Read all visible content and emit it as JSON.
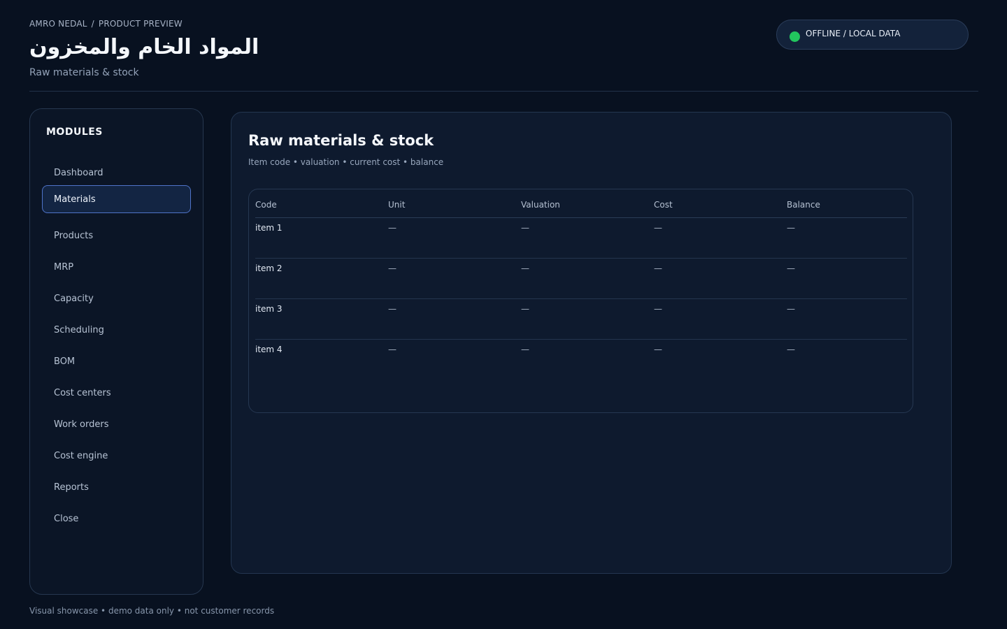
{
  "breadcrumb": {
    "owner": "AMRO NEDAL",
    "separator": "/",
    "section": "PRODUCT PREVIEW"
  },
  "header": {
    "title": "المواد الخام والمخزون",
    "subtitle": "Raw materials & stock"
  },
  "status": {
    "label": "OFFLINE / LOCAL DATA",
    "color": "#22c55e"
  },
  "sidebar": {
    "heading": "MODULES",
    "active": "Materials",
    "items": [
      {
        "label": "Dashboard"
      },
      {
        "label": "Materials"
      },
      {
        "label": "Products"
      },
      {
        "label": "MRP"
      },
      {
        "label": "Capacity"
      },
      {
        "label": "Scheduling"
      },
      {
        "label": "BOM"
      },
      {
        "label": "Cost centers"
      },
      {
        "label": "Work orders"
      },
      {
        "label": "Cost engine"
      },
      {
        "label": "Reports"
      },
      {
        "label": "Close"
      }
    ]
  },
  "panel": {
    "title": "Raw materials & stock",
    "subtitle": "Item code • valuation • current cost • balance"
  },
  "table": {
    "columns": [
      "Code",
      "Unit",
      "Valuation",
      "Cost",
      "Balance"
    ],
    "rows": [
      [
        "item 1",
        "—",
        "—",
        "—",
        "—"
      ],
      [
        "item 2",
        "—",
        "—",
        "—",
        "—"
      ],
      [
        "item 3",
        "—",
        "—",
        "—",
        "—"
      ],
      [
        "item 4",
        "—",
        "—",
        "—",
        "—"
      ]
    ]
  },
  "footer": {
    "note": "Visual showcase • demo data only • not customer records"
  },
  "colors": {
    "background": "#081120",
    "panel": "#0e1a2e",
    "active_border": "#4f74c9",
    "status_ok": "#22c55e"
  }
}
